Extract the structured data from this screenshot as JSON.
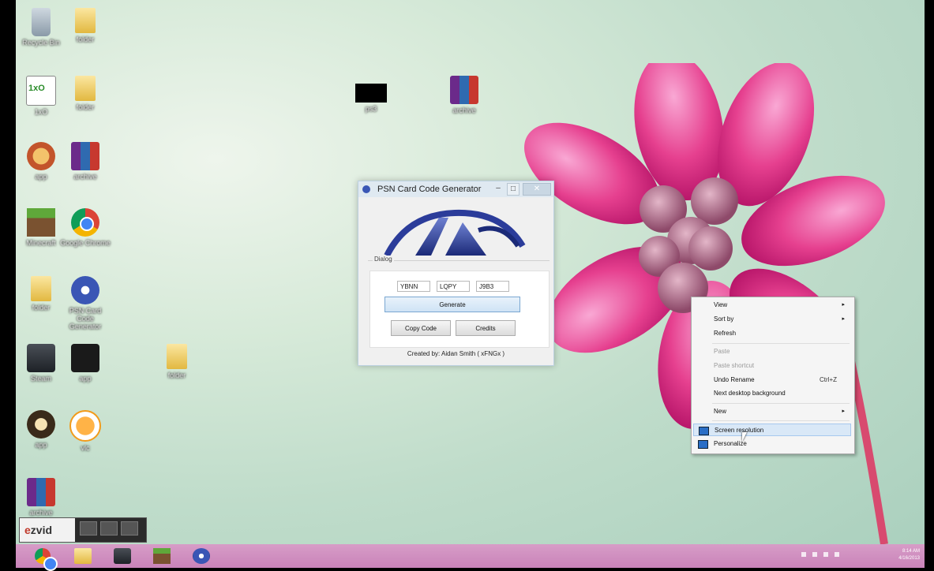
{
  "desktop": {
    "icons": [
      {
        "label": "Recycle Bin",
        "glyph": "recycle-bin-icon"
      },
      {
        "label": "folder",
        "glyph": "folder-icon"
      },
      {
        "label": "1xO",
        "glyph": "app-icon"
      },
      {
        "label": "folder",
        "glyph": "folder-icon"
      },
      {
        "label": "app",
        "glyph": "app-icon"
      },
      {
        "label": "archive",
        "glyph": "winrar-icon"
      },
      {
        "label": "Minecraft",
        "glyph": "minecraft-icon"
      },
      {
        "label": "Google Chrome",
        "glyph": "chrome-icon"
      },
      {
        "label": "folder",
        "glyph": "folder-icon"
      },
      {
        "label": "PSN Card Code Generator",
        "glyph": "psn-icon"
      },
      {
        "label": "Steam",
        "glyph": "steam-icon"
      },
      {
        "label": "app",
        "glyph": "app-icon"
      },
      {
        "label": "app",
        "glyph": "app-icon"
      },
      {
        "label": "vlc",
        "glyph": "vlc-icon"
      },
      {
        "label": "archive",
        "glyph": "winrar-icon"
      },
      {
        "label": "ps3",
        "glyph": "ps3-icon"
      },
      {
        "label": "archive",
        "glyph": "winrar-icon"
      },
      {
        "label": "folder",
        "glyph": "folder-icon"
      }
    ]
  },
  "dialog": {
    "title": "PSN Card Code Generator",
    "minimize": "–",
    "maximize": "□",
    "close": "✕",
    "group_label": "Dialog",
    "code1": "YBNN",
    "code2": "LQPY",
    "code3": "J9B3",
    "generate_label": "Generate",
    "copy_label": "Copy Code",
    "credits_label": "Credits",
    "footer": "Created by: Aidan Smith ( xFNGx )"
  },
  "context_menu": {
    "items": [
      {
        "label": "View",
        "submenu": "▸"
      },
      {
        "label": "Sort by",
        "submenu": "▸"
      },
      {
        "label": "Refresh"
      },
      {
        "label": "Paste"
      },
      {
        "label": "Paste shortcut"
      },
      {
        "label": "Undo Rename",
        "shortcut": "Ctrl+Z"
      },
      {
        "label": "Next desktop background"
      },
      {
        "label": "New",
        "submenu": "▸"
      },
      {
        "label": "Screen resolution"
      },
      {
        "label": "Personalize"
      }
    ]
  },
  "taskbar": {
    "items": [
      "chrome-icon",
      "file-explorer-icon",
      "steam-icon",
      "minecraft-icon",
      "psn-icon"
    ],
    "clock_time": "8:14 AM",
    "clock_date": "4/16/2013"
  },
  "ezvid": {
    "logo_e": "e",
    "logo_rest": "zvid"
  },
  "colors": {
    "taskbar": "#c983b9",
    "accent": "#3a56b5"
  }
}
